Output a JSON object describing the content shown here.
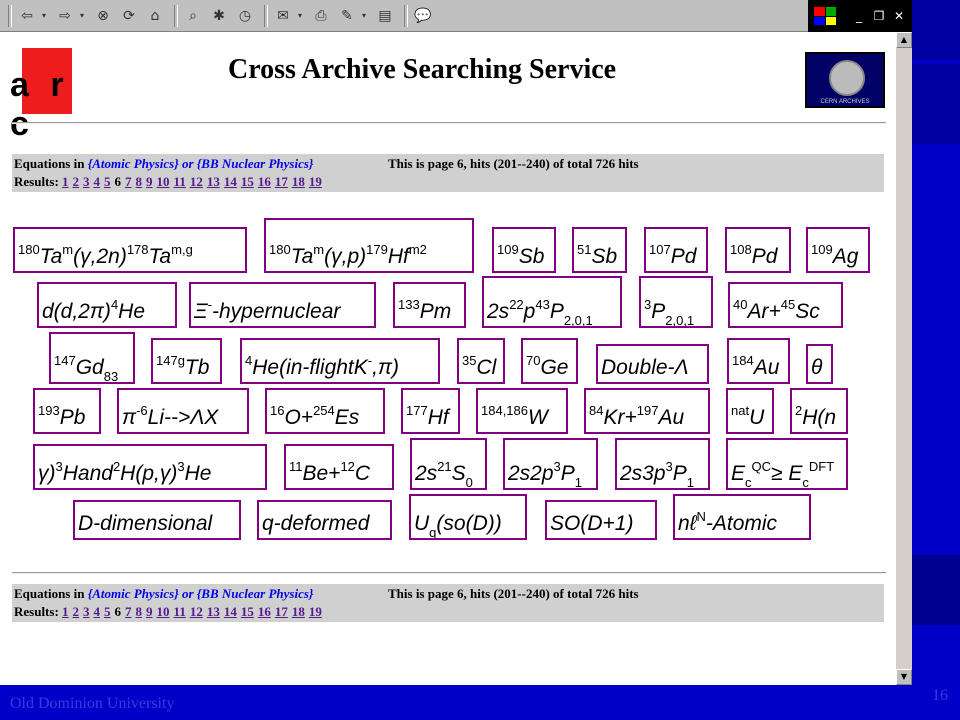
{
  "page": {
    "title": "Cross Archive Searching Service",
    "logo_text": "a r c",
    "cern_label": "CERN ARCHIVES"
  },
  "info": {
    "equations_in": "Equations in",
    "query": "{Atomic Physics} or {BB Nuclear Physics}",
    "page_status": "This is page 6, hits (201--240) of total 726 hits",
    "results_label": "Results:",
    "pages": [
      "1",
      "2",
      "3",
      "4",
      "5",
      "6",
      "7",
      "8",
      "9",
      "10",
      "11",
      "12",
      "13",
      "14",
      "15",
      "16",
      "17",
      "18",
      "19"
    ],
    "current_page": "6"
  },
  "footer": {
    "org": "Old Dominion University",
    "slide_number": "16"
  },
  "equations": [
    "¹⁸⁰Taᵐ(γ,2n)¹⁷⁸Taᵐ·ᵍ",
    "¹⁸⁰Taᵐ(γ,p)¹⁷⁹Hfᵐ²",
    "¹⁰⁹Sb",
    "⁵¹Sb",
    "¹⁰⁷Pd",
    "¹⁰⁸Pd",
    "¹⁰⁹Ag",
    "d(d,2π)⁴He",
    "Ξ⁻-hypernuclear",
    "¹³³Pm",
    "2s²²p⁴³P₂,₀,₁",
    "³P₂,₀,₁",
    "⁴⁰Ar+⁴⁵Sc",
    "¹⁴⁷₆₄Gd₈₃",
    "¹⁴⁷ᵍTb",
    "⁴He(in-flightK⁻,π)",
    "³⁵Cl",
    "⁷⁰Ge",
    "Double-Λ",
    "¹⁸⁴Au",
    "θ",
    "¹⁹³Pb",
    "π⁻⁶Li-->ΛX",
    "¹⁶O+²⁵⁴Es",
    "¹⁷⁷Hf",
    "¹⁸⁴·¹⁸⁶W",
    "⁸⁴Kr+¹⁹⁷Au",
    "ⁿᵃᵗU",
    "²H(n",
    "γ)³Hand²H(p,γ)³He",
    "¹¹Be+¹²C",
    "2s²¹S₀",
    "2s2p³P₁",
    "2s3p³P₁",
    "E_c^QC ≥ E_c^DFT",
    "D-dimensional",
    "q-deformed",
    "U_q(so(D))",
    "SO(D+1)",
    "nℓᴺ-Atomic"
  ]
}
